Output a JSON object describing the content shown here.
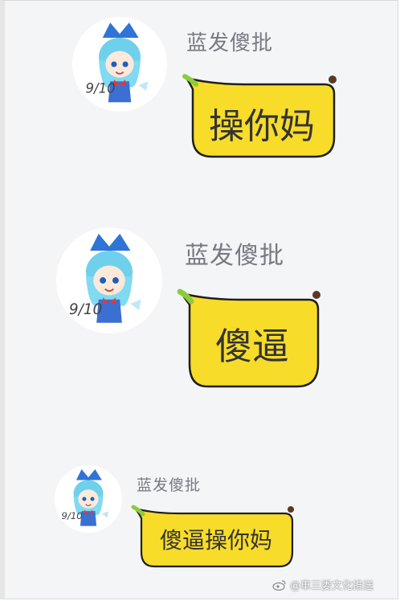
{
  "messages": [
    {
      "sender": "蓝发傻批",
      "text": "操你妈"
    },
    {
      "sender": "蓝发傻批",
      "text": "傻逼"
    },
    {
      "sender": "蓝发傻批",
      "text": "傻逼操你妈"
    }
  ],
  "avatar": {
    "caption": "9/10",
    "icon": "cirno-chibi-avatar"
  },
  "bubble_style": {
    "fill": "#f7dc2a",
    "stroke": "#1f1f1f",
    "tip_green": "#8ccc3a",
    "tip_brown": "#5a3a22"
  },
  "watermark": {
    "icon": "weibo-icon",
    "text": "@車三委文化推送"
  }
}
